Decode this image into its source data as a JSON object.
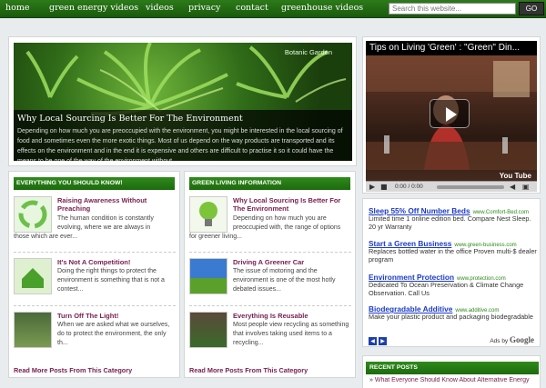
{
  "nav": {
    "items": [
      "home",
      "green energy videos",
      "videos",
      "privacy",
      "contact",
      "greenhouse videos"
    ],
    "search_placeholder": "Search this website...",
    "search_button": "GO"
  },
  "featured": {
    "image_tag": "Botanic Garden",
    "title": "Why Local Sourcing Is Better For The Environment",
    "text": "Depending on how much you are preoccupied with the environment, you might be interested in the local sourcing of food and sometimes even the more exotic things. Most of us depend on the way products are transported and its effects on the environment and in the end it is expensive and others are difficult to practise it so it could have the means to be one of the way of the environment without"
  },
  "video": {
    "title": "Tips on Living 'Green' : \"Green\" Din...",
    "time": "0:00 / 0:00",
    "logo": "You Tube"
  },
  "col1": {
    "heading": "EVERYTHING YOU SHOULD KNOW!",
    "posts": [
      {
        "title": "Raising Awareness Without Preaching",
        "text": "The human condition is constantly evolving, where we are always in",
        "text_cont": "those which are ever..."
      },
      {
        "title": "It's Not A Competition!",
        "text": "Doing the right things to protect the environment is something that is not a contest..."
      },
      {
        "title": "Turn Off The Light!",
        "text": "When we are asked what we ourselves, do to protect the environment, the only th..."
      }
    ],
    "read_more": "Read More Posts From This Category"
  },
  "col2": {
    "heading": "GREEN LIVING INFORMATION",
    "posts": [
      {
        "title": "Why Local Sourcing Is Better For The Environment",
        "text": "Depending on how much you are preoccupied with, the range of options",
        "text_cont": "for greener living..."
      },
      {
        "title": "Driving A Greener Car",
        "text": "The issue of motoring and the environment is one of the most hotly debated issues..."
      },
      {
        "title": "Everything Is Reusable",
        "text": "Most people view recycling as something that involves taking used items to a recycling..."
      }
    ],
    "read_more": "Read More Posts From This Category"
  },
  "ads": {
    "items": [
      {
        "title": "Sleep 55% Off Number Beds",
        "url": "www.Comfort-Bed.com",
        "text": "Limited time 1 online edition bed. Compare Nest Sleep. 20 yr Warranty"
      },
      {
        "title": "Start a Green Business",
        "url": "www.green-business.com",
        "text": "Replaces bottled water in the office Proven multi-$ dealer program"
      },
      {
        "title": "Environment Protection",
        "url": "www.protection.com",
        "text": "Dedicated To Ocean Preservation & Climate Change Observation. Call Us"
      },
      {
        "title": "Biodegradable Additive",
        "url": "www.additive.com",
        "text": "Make your plastic product and packaging biodegradable"
      }
    ],
    "ads_by": "Ads by",
    "google": "Google"
  },
  "recent": {
    "heading": "RECENT POSTS",
    "first_post": "What Everyone Should Know About Alternative Energy"
  },
  "colors": {
    "nav": "#2d7a1a",
    "accent": "#1d6a0e",
    "post_link": "#7a2050",
    "ad_title": "#1a3ac9"
  }
}
